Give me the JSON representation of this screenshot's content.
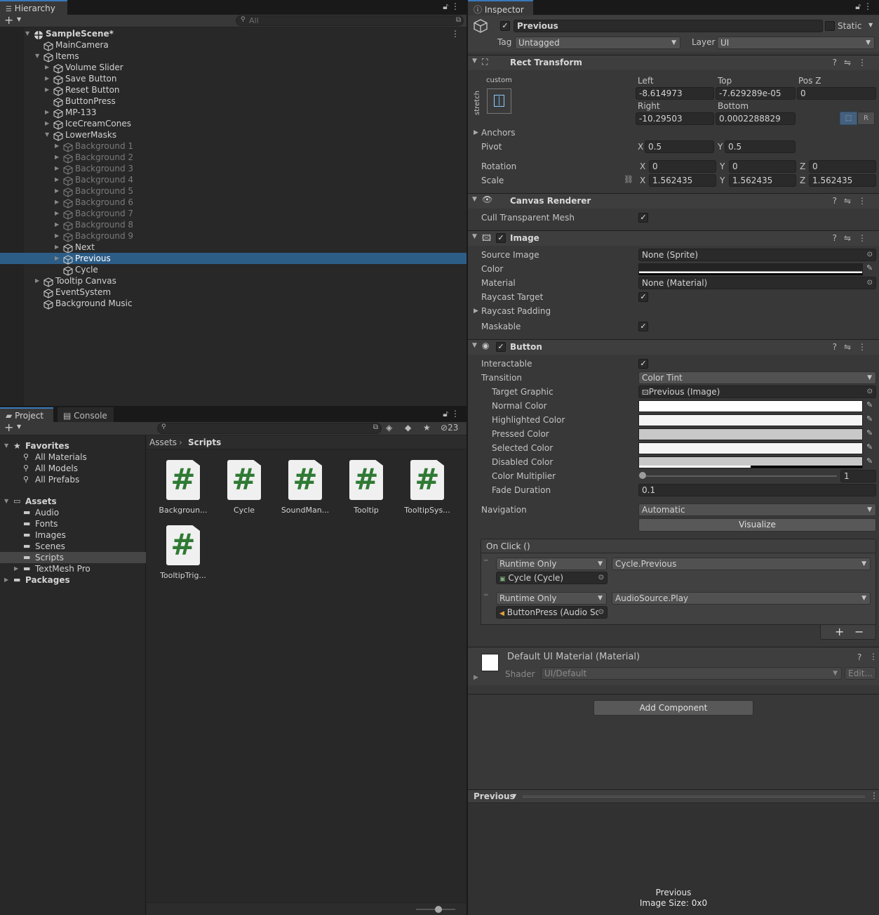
{
  "hierarchy": {
    "tab_label": "Hierarchy",
    "search_placeholder": "All",
    "add_label": "+",
    "rows": [
      {
        "label": "SampleScene*",
        "indent": 0,
        "arrow": "down",
        "kind": "scene",
        "state": "bold"
      },
      {
        "label": "MainCamera",
        "indent": 1,
        "arrow": "",
        "kind": "cube",
        "state": ""
      },
      {
        "label": "Items",
        "indent": 1,
        "arrow": "down",
        "kind": "cube",
        "state": ""
      },
      {
        "label": "Volume Slider",
        "indent": 2,
        "arrow": "right",
        "kind": "cube",
        "state": ""
      },
      {
        "label": "Save Button",
        "indent": 2,
        "arrow": "right",
        "kind": "cube",
        "state": ""
      },
      {
        "label": "Reset Button",
        "indent": 2,
        "arrow": "right",
        "kind": "cube",
        "state": ""
      },
      {
        "label": "ButtonPress",
        "indent": 2,
        "arrow": "",
        "kind": "cube",
        "state": ""
      },
      {
        "label": "MP-133",
        "indent": 2,
        "arrow": "right",
        "kind": "cube",
        "state": ""
      },
      {
        "label": "IceCreamCones",
        "indent": 2,
        "arrow": "right",
        "kind": "cube",
        "state": ""
      },
      {
        "label": "LowerMasks",
        "indent": 2,
        "arrow": "down",
        "kind": "cube",
        "state": ""
      },
      {
        "label": "Background 1",
        "indent": 3,
        "arrow": "right",
        "kind": "cube",
        "state": "disabled"
      },
      {
        "label": "Background 2",
        "indent": 3,
        "arrow": "right",
        "kind": "cube",
        "state": "disabled"
      },
      {
        "label": "Background 3",
        "indent": 3,
        "arrow": "right",
        "kind": "cube",
        "state": "disabled"
      },
      {
        "label": "Background 4",
        "indent": 3,
        "arrow": "right",
        "kind": "cube",
        "state": "disabled"
      },
      {
        "label": "Background 5",
        "indent": 3,
        "arrow": "right",
        "kind": "cube",
        "state": "disabled"
      },
      {
        "label": "Background 6",
        "indent": 3,
        "arrow": "right",
        "kind": "cube",
        "state": "disabled"
      },
      {
        "label": "Background 7",
        "indent": 3,
        "arrow": "right",
        "kind": "cube",
        "state": "disabled"
      },
      {
        "label": "Background 8",
        "indent": 3,
        "arrow": "right",
        "kind": "cube",
        "state": "disabled"
      },
      {
        "label": "Background 9",
        "indent": 3,
        "arrow": "right",
        "kind": "cube",
        "state": "disabled"
      },
      {
        "label": "Next",
        "indent": 3,
        "arrow": "right",
        "kind": "cube",
        "state": ""
      },
      {
        "label": "Previous",
        "indent": 3,
        "arrow": "right",
        "kind": "cube",
        "state": "selected"
      },
      {
        "label": "Cycle",
        "indent": 3,
        "arrow": "",
        "kind": "cube",
        "state": ""
      },
      {
        "label": "Tooltip Canvas",
        "indent": 1,
        "arrow": "right",
        "kind": "cube",
        "state": ""
      },
      {
        "label": "EventSystem",
        "indent": 1,
        "arrow": "",
        "kind": "cube",
        "state": ""
      },
      {
        "label": "Background Music",
        "indent": 1,
        "arrow": "",
        "kind": "cube",
        "state": ""
      }
    ]
  },
  "project": {
    "tab_project": "Project",
    "tab_console": "Console",
    "hidden_count": "23",
    "breadcrumb": [
      "Assets",
      "Scripts"
    ],
    "tree": [
      {
        "label": "Favorites",
        "indent": 0,
        "arrow": "down",
        "kind": "star",
        "state": "bold"
      },
      {
        "label": "All Materials",
        "indent": 1,
        "arrow": "",
        "kind": "search",
        "state": ""
      },
      {
        "label": "All Models",
        "indent": 1,
        "arrow": "",
        "kind": "search",
        "state": ""
      },
      {
        "label": "All Prefabs",
        "indent": 1,
        "arrow": "",
        "kind": "search",
        "state": ""
      },
      {
        "label": "",
        "indent": 0,
        "arrow": "",
        "kind": "none",
        "state": "spacer"
      },
      {
        "label": "Assets",
        "indent": 0,
        "arrow": "down",
        "kind": "folder-open",
        "state": "bold"
      },
      {
        "label": "Audio",
        "indent": 1,
        "arrow": "",
        "kind": "folder",
        "state": ""
      },
      {
        "label": "Fonts",
        "indent": 1,
        "arrow": "",
        "kind": "folder",
        "state": ""
      },
      {
        "label": "Images",
        "indent": 1,
        "arrow": "",
        "kind": "folder",
        "state": ""
      },
      {
        "label": "Scenes",
        "indent": 1,
        "arrow": "",
        "kind": "folder",
        "state": ""
      },
      {
        "label": "Scripts",
        "indent": 1,
        "arrow": "",
        "kind": "folder",
        "state": "selected"
      },
      {
        "label": "TextMesh Pro",
        "indent": 1,
        "arrow": "right",
        "kind": "folder",
        "state": ""
      },
      {
        "label": "Packages",
        "indent": 0,
        "arrow": "right",
        "kind": "folder",
        "state": "bold"
      }
    ],
    "assets": [
      {
        "name": "Backgroun..."
      },
      {
        "name": "Cycle"
      },
      {
        "name": "SoundMan..."
      },
      {
        "name": "Tooltip"
      },
      {
        "name": "TooltipSys..."
      },
      {
        "name": "TooltipTrig..."
      }
    ]
  },
  "inspector": {
    "tab_label": "Inspector",
    "object_name": "Previous",
    "static_label": "Static",
    "tag_label": "Tag",
    "tag_value": "Untagged",
    "layer_label": "Layer",
    "layer_value": "UI",
    "rect_transform": {
      "title": "Rect Transform",
      "preset_label": "custom",
      "stretch_label": "stretch",
      "left_label": "Left",
      "left_value": "-8.614973",
      "top_label": "Top",
      "top_value": "-7.629289e-05",
      "posz_label": "Pos Z",
      "posz_value": "0",
      "right_label": "Right",
      "right_value": "-10.29503",
      "bottom_label": "Bottom",
      "bottom_value": "0.0002288829",
      "r_button": "R",
      "anchors_label": "Anchors",
      "pivot_label": "Pivot",
      "pivot_x": "0.5",
      "pivot_y": "0.5",
      "rotation_label": "Rotation",
      "rot_x": "0",
      "rot_y": "0",
      "rot_z": "0",
      "scale_label": "Scale",
      "scale_x": "1.562435",
      "scale_y": "1.562435",
      "scale_z": "1.562435",
      "x": "X",
      "y": "Y",
      "z": "Z"
    },
    "canvas_renderer": {
      "title": "Canvas Renderer",
      "cull_label": "Cull Transparent Mesh"
    },
    "image": {
      "title": "Image",
      "source_label": "Source Image",
      "source_value": "None (Sprite)",
      "color_label": "Color",
      "material_label": "Material",
      "material_value": "None (Material)",
      "raycast_label": "Raycast Target",
      "raycast_padding_label": "Raycast Padding",
      "maskable_label": "Maskable"
    },
    "button": {
      "title": "Button",
      "interactable_label": "Interactable",
      "transition_label": "Transition",
      "transition_value": "Color Tint",
      "target_label": "Target Graphic",
      "target_value": "Previous (Image)",
      "normal_label": "Normal Color",
      "highlighted_label": "Highlighted Color",
      "pressed_label": "Pressed Color",
      "selected_label": "Selected Color",
      "disabled_label": "Disabled Color",
      "multiplier_label": "Color Multiplier",
      "multiplier_value": "1",
      "fade_label": "Fade Duration",
      "fade_value": "0.1",
      "navigation_label": "Navigation",
      "navigation_value": "Automatic",
      "visualize_label": "Visualize",
      "onclick_label": "On Click ()",
      "events": [
        {
          "mode": "Runtime Only",
          "function": "Cycle.Previous",
          "target": "Cycle (Cycle)"
        },
        {
          "mode": "Runtime Only",
          "function": "AudioSource.Play",
          "target": "ButtonPress (Audio So"
        }
      ],
      "plus": "+",
      "minus": "−"
    },
    "material": {
      "title": "Default UI Material (Material)",
      "shader_label": "Shader",
      "shader_value": "UI/Default",
      "edit_label": "Edit..."
    },
    "add_component_label": "Add Component",
    "preview": {
      "title": "Previous",
      "caption_name": "Previous",
      "caption_size": "Image Size: 0x0"
    },
    "colors": {
      "normal": "#ffffff",
      "highlighted": "#f5f5f5",
      "pressed": "#c8c8c8",
      "selected": "#f5f5f5",
      "disabled": "#c8c8c8",
      "image_color": "#000000"
    }
  },
  "theme": {
    "accent": "#3a79bb",
    "selection": "#2c5d87",
    "panel": "#383838",
    "dark_panel": "#282828",
    "script_icon_green": "#2f7a34"
  }
}
